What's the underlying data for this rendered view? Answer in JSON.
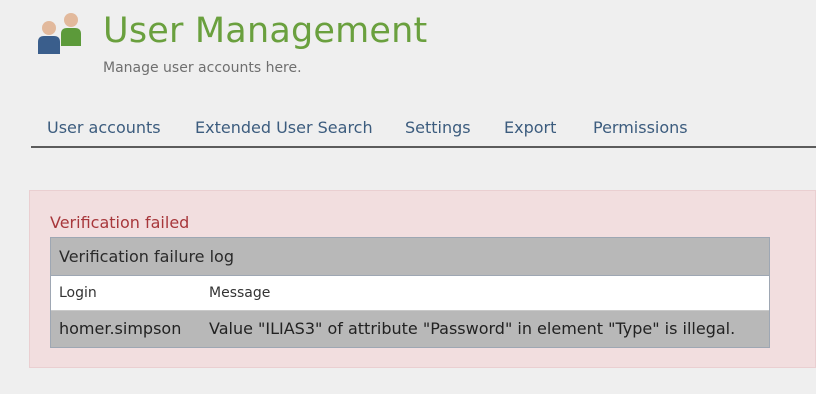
{
  "header": {
    "icon": "users-icon",
    "title": "User Management",
    "subtitle": "Manage user accounts here."
  },
  "tabs": [
    {
      "label": "User accounts"
    },
    {
      "label": "Extended User Search"
    },
    {
      "label": "Settings"
    },
    {
      "label": "Export"
    },
    {
      "label": "Permissions"
    }
  ],
  "alert": {
    "title": "Verification failed",
    "table": {
      "caption": "Verification failure log",
      "columns": [
        "Login",
        "Message"
      ],
      "rows": [
        {
          "login": "homer.simpson",
          "message": "Value \"ILIAS3\" of attribute \"Password\" in element \"Type\" is illegal."
        }
      ]
    }
  },
  "colors": {
    "title": "#6aa03e",
    "tab_text": "#3c5c7e",
    "alert_bg": "#f2dedf",
    "alert_text": "#a7373b",
    "table_header_bg": "#b8b8b8"
  }
}
